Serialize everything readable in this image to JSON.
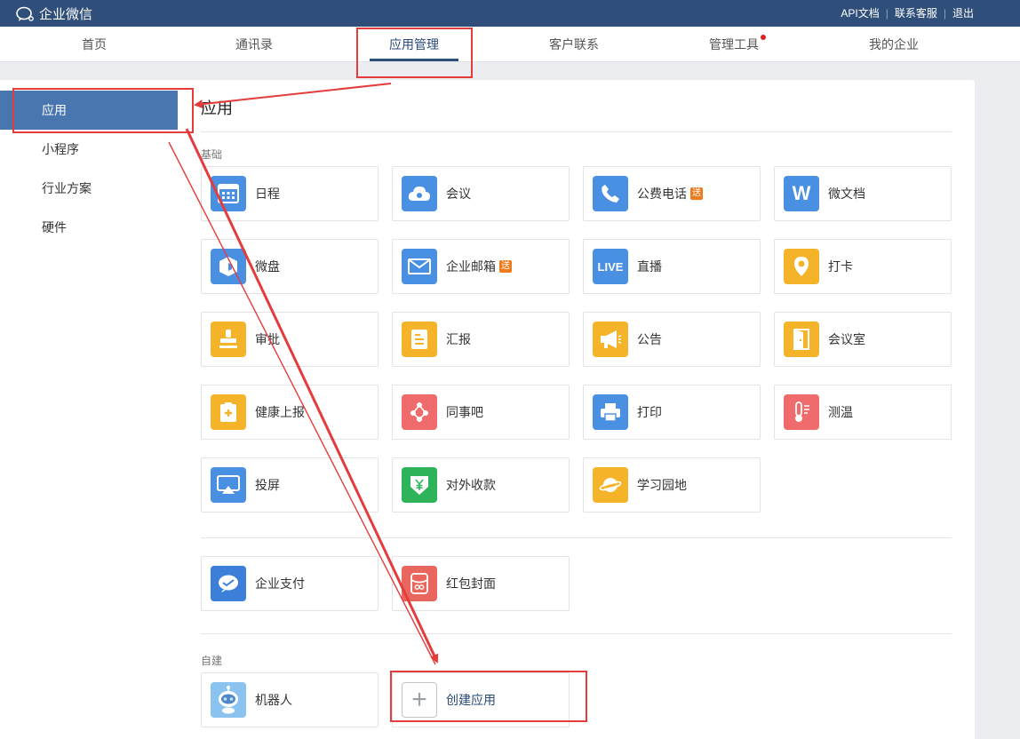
{
  "topbar": {
    "logo_text": "企业微信",
    "links": [
      "API文档",
      "联系客服",
      "退出"
    ]
  },
  "nav": {
    "tabs": [
      {
        "label": "首页",
        "active": false
      },
      {
        "label": "通讯录",
        "active": false
      },
      {
        "label": "应用管理",
        "active": true
      },
      {
        "label": "客户联系",
        "active": false
      },
      {
        "label": "管理工具",
        "active": false,
        "dot": true
      },
      {
        "label": "我的企业",
        "active": false
      }
    ]
  },
  "sidebar": {
    "items": [
      {
        "label": "应用",
        "active": true
      },
      {
        "label": "小程序",
        "active": false
      },
      {
        "label": "行业方案",
        "active": false
      },
      {
        "label": "硬件",
        "active": false
      }
    ]
  },
  "main": {
    "title": "应用",
    "sections": {
      "basic_label": "基础",
      "custom_label": "自建"
    },
    "basic_apps": [
      {
        "name": "日程",
        "icon": "calendar-icon",
        "color": "#4a90e2"
      },
      {
        "name": "会议",
        "icon": "cloud-meeting-icon",
        "color": "#4a90e2"
      },
      {
        "name": "公费电话",
        "icon": "phone-icon",
        "color": "#4a90e2",
        "badge": "送"
      },
      {
        "name": "微文档",
        "icon": "w-doc-icon",
        "color": "#4a90e2"
      },
      {
        "name": "微盘",
        "icon": "disk-icon",
        "color": "#4a90e2"
      },
      {
        "name": "企业邮箱",
        "icon": "mail-icon",
        "color": "#4a90e2",
        "badge": "送"
      },
      {
        "name": "直播",
        "icon": "live-icon",
        "color": "#4a90e2"
      },
      {
        "name": "打卡",
        "icon": "location-pin-icon",
        "color": "#f5b32a"
      },
      {
        "name": "审批",
        "icon": "stamp-icon",
        "color": "#f5b32a"
      },
      {
        "name": "汇报",
        "icon": "report-icon",
        "color": "#f5b32a"
      },
      {
        "name": "公告",
        "icon": "megaphone-icon",
        "color": "#f5b32a"
      },
      {
        "name": "会议室",
        "icon": "door-icon",
        "color": "#f5b32a"
      },
      {
        "name": "健康上报",
        "icon": "health-report-icon",
        "color": "#f5b32a"
      },
      {
        "name": "同事吧",
        "icon": "colleague-icon",
        "color": "#f06b6b"
      },
      {
        "name": "打印",
        "icon": "printer-icon",
        "color": "#4a90e2"
      },
      {
        "name": "测温",
        "icon": "thermometer-icon",
        "color": "#f06b6b"
      },
      {
        "name": "投屏",
        "icon": "screen-cast-icon",
        "color": "#4a90e2"
      },
      {
        "name": "对外收款",
        "icon": "yuan-shield-icon",
        "color": "#2eb35a"
      },
      {
        "name": "学习园地",
        "icon": "planet-icon",
        "color": "#f5b32a"
      }
    ],
    "pay_apps": [
      {
        "name": "企业支付",
        "icon": "enterprise-pay-icon",
        "color": "#3b7fd9"
      },
      {
        "name": "红包封面",
        "icon": "red-envelope-icon",
        "color": "#e8665e"
      }
    ],
    "custom_apps": [
      {
        "name": "机器人",
        "icon": "robot-icon",
        "color": "#8ac3f0"
      },
      {
        "name": "创建应用",
        "icon": "plus-icon",
        "color": "#ffffff"
      }
    ]
  },
  "annotation_color": "#e43b3b"
}
